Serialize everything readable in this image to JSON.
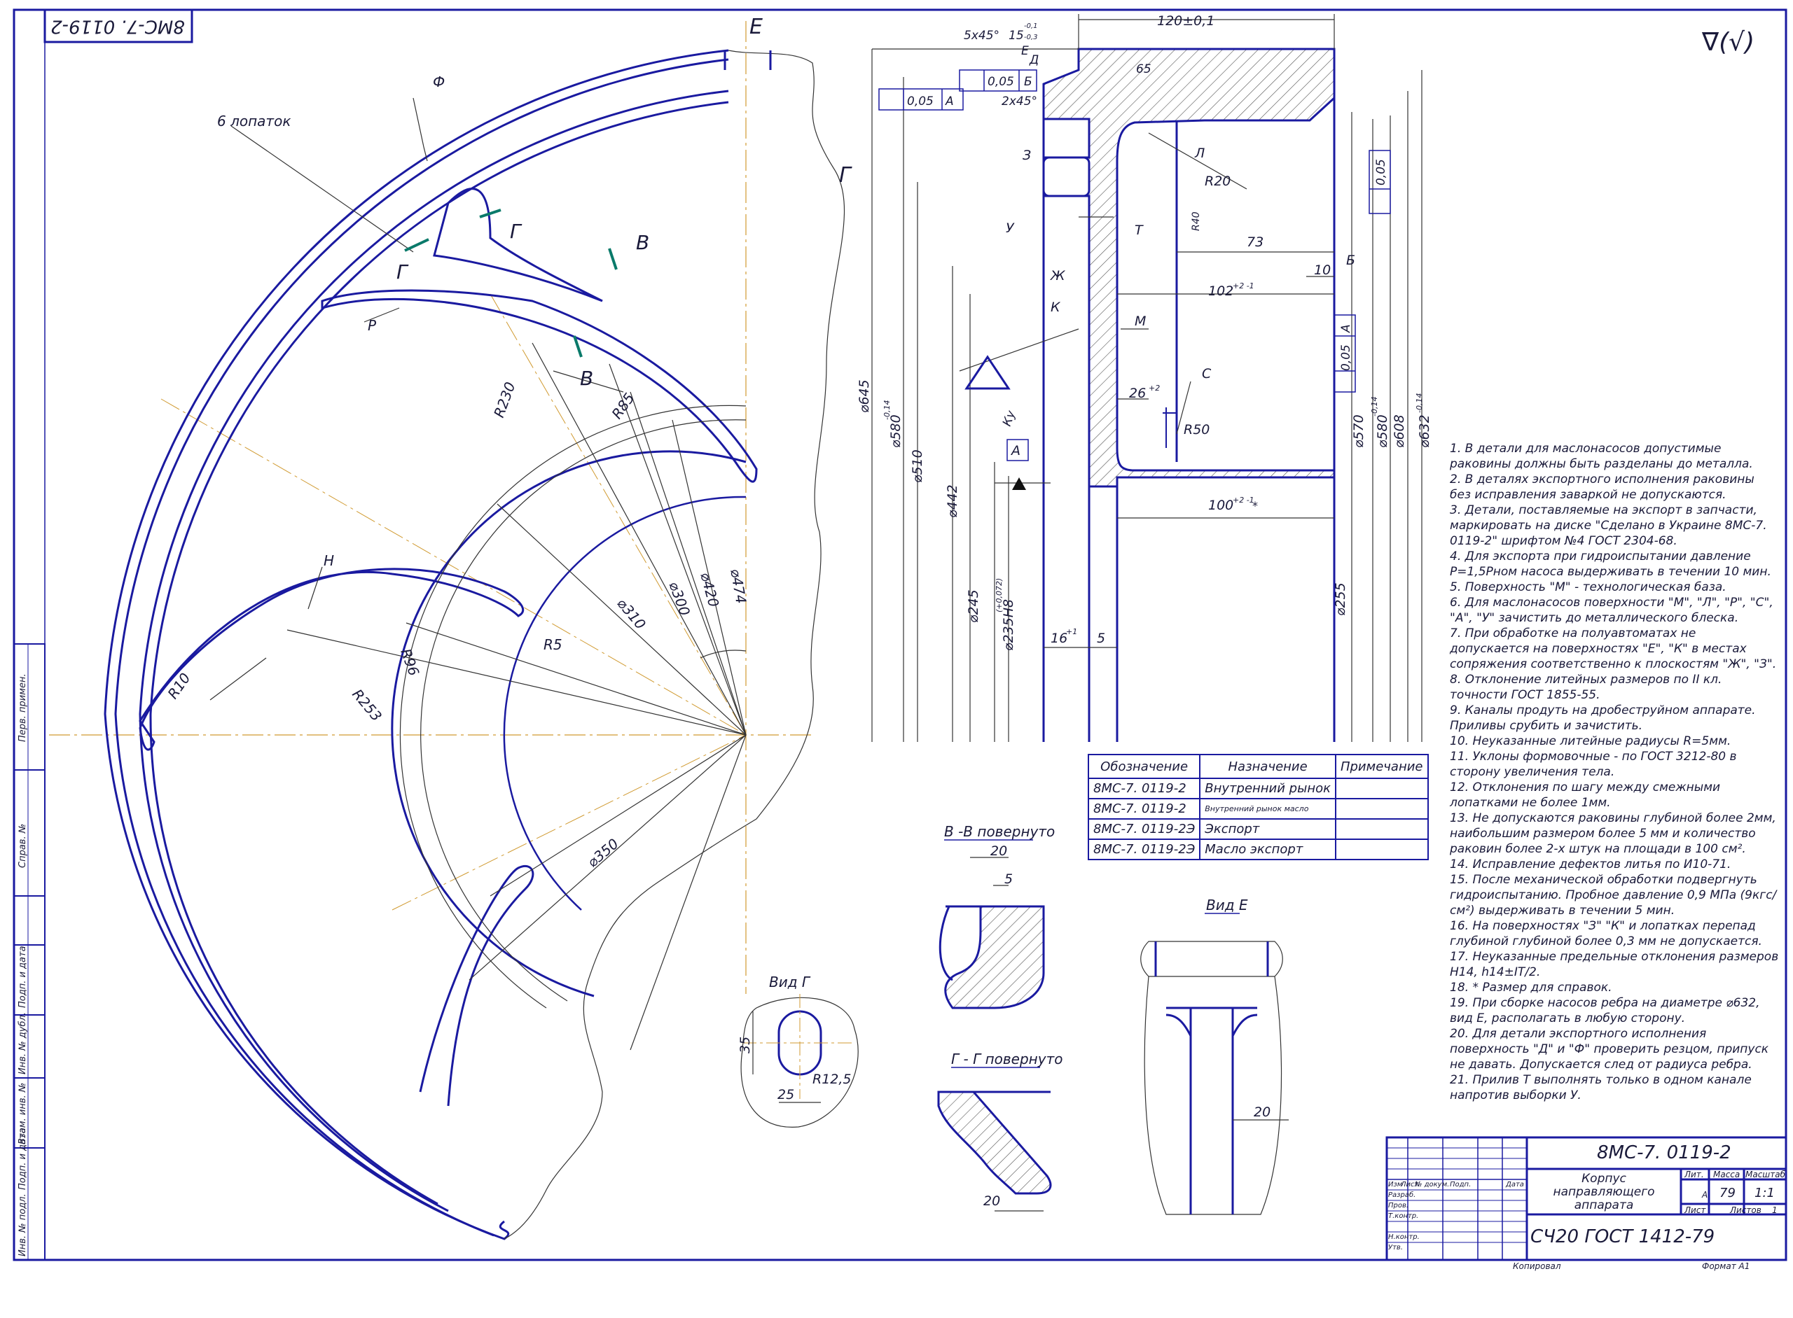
{
  "stamp_top": "8МС-7. 0119-2",
  "view_arrows": {
    "e": "Е",
    "g": "Г",
    "v1": "В",
    "v2": "В",
    "g2": "Г",
    "g3": "Г"
  },
  "plan_labels": {
    "f": "Ф",
    "blades": "6 лопаток",
    "p": "Р",
    "n": "Н",
    "r230": "R230",
    "r85": "R85",
    "r96": "R96",
    "r253": "R253",
    "r10": "R10",
    "r5": "R5",
    "d300": "⌀300",
    "d420": "⌀420",
    "d474": "⌀474",
    "d310": "⌀310",
    "d350": "⌀350"
  },
  "section_labels": {
    "dim120": "120±0,1",
    "chamfer1": "5х45°",
    "dim15": "15",
    "dim15_tol_up": "-0,1",
    "dim15_tol_dn": "-0,3",
    "e": "Е",
    "d": "Д",
    "dim65": "65",
    "tol1_val": "0,05",
    "tol1_ref": "Б",
    "tol2_val": "0,05",
    "tol2_ref": "А",
    "chamfer2": "2х45°",
    "z": "З",
    "u": "У",
    "t": "Т",
    "zh": "Ж",
    "k": "К",
    "m": "М",
    "l": "Л",
    "s": "С",
    "ku": "Ку",
    "r20": "R20",
    "r40": "R40",
    "r50": "R50",
    "dim73": "73",
    "dim10": "10",
    "b": "Б",
    "dim102": "102",
    "dim102_tol": "+2 -1",
    "dim26": "26",
    "dim26_tol": "+2",
    "dim100": "100",
    "dim100_tol": "+2 -1",
    "dim100_star": "*",
    "dim16": "16",
    "dim16_tol": "+1",
    "dim5": "5",
    "datum_a": "А",
    "tol3_val": "0,05",
    "tol3_ref": "А",
    "tol4_val": "0,05",
    "d645": "⌀645",
    "d580": "⌀580",
    "d580_tol": "-0,14",
    "d510": "⌀510",
    "d442": "⌀442",
    "d245": "⌀245",
    "d235": "⌀235Н8",
    "d235_tol": "(+0,072)",
    "d255": "⌀255",
    "d570": "⌀570",
    "d580b": "⌀580",
    "d580b_tol": "-0,14",
    "d608": "⌀608",
    "d632": "⌀632",
    "d632_tol": "-0,14",
    "rough": "∇(√)"
  },
  "views": {
    "v_title": "В -В повернуто",
    "v_dim20": "20",
    "v_dim5": "5",
    "g_title": "Г - Г повернуто",
    "g_dim20": "20",
    "vg_title": "Вид Г",
    "vg_dim35": "35",
    "vg_dim25": "25",
    "vg_r": "R12,5",
    "ve_title": "Вид Е",
    "ve_dim20": "20"
  },
  "spec_table": {
    "headers": [
      "Обозначение",
      "Назначение",
      "Примечание"
    ],
    "rows": [
      [
        "8МС-7. 0119-2",
        "Внутренний рынок",
        ""
      ],
      [
        "8МС-7. 0119-2",
        "Внутренний рынок масло",
        ""
      ],
      [
        "8МС-7. 0119-2Э",
        "Экспорт",
        ""
      ],
      [
        "8МС-7. 0119-2Э",
        "Масло экспорт",
        ""
      ]
    ]
  },
  "notes": [
    "1. В детали для маслонасосов допустимые раковины должны быть разделаны до металла.",
    "2. В деталях экспортного исполнения раковины без исправления заваркой не допускаются.",
    "3. Детали, поставляемые на экспорт в запчасти, маркировать на диске \"Сделано в Украине 8МС-7. 0119-2\" шрифтом №4 ГОСТ 2304-68.",
    "4. Для экспорта при гидроиспытании давление Р=1,5Рном насоса выдерживать в течении 10 мин.",
    "5. Поверхность \"М\" - технологическая база.",
    "6. Для маслонасосов поверхности \"М\", \"Л\", \"Р\", \"С\", \"А\", \"У\" зачистить до металлического блеска.",
    "7. При обработке на полуавтоматах не допускается на поверхностях \"Е\", \"К\" в местах сопряжения соответственно к плоскостям \"Ж\", \"З\".",
    "8. Отклонение литейных размеров по II кл. точности ГОСТ 1855-55.",
    "9. Каналы продуть на дробеструйном аппарате. Приливы срубить и зачистить.",
    "10. Неуказанные литейные радиусы R=5мм.",
    "11. Уклоны формовочные - по ГОСТ 3212-80 в сторону увеличения тела.",
    "12. Отклонения по шагу между смежными лопатками не более 1мм.",
    "13. Не допускаются раковины глубиной более 2мм, наибольшим размером более 5 мм и количество раковин более 2-х штук на площади в 100 см².",
    "14. Исправление дефектов литья по И10-71.",
    "15. После механической обработки подвергнуть гидроиспытанию. Пробное давление 0,9 МПа (9кгс/см²) выдерживать в течении 5 мин.",
    "16. На поверхностях \"З\" \"К\" и лопатках перепад глубиной глубиной более 0,3 мм не допускается.",
    "17. Неуказанные предельные отклонения размеров Н14, h14±IT/2.",
    "18. * Размер для справок.",
    "19. При сборке насосов ребра на диаметре ⌀632, вид Е, располагать в любую сторону.",
    "20. Для детали экспортного исполнения поверхность \"Д\" и \"Ф\" проверить резцом, припуск не давать. Допускается след от радиуса ребра.",
    "21. Прилив Т выполнять только в одном канале напротив выборки У."
  ],
  "title_block": {
    "doc_number": "8МС-7. 0119-2",
    "part_name": "Корпус направляющего аппарата",
    "material": "СЧ20 ГОСТ 1412-79",
    "lit_label": "Лит.",
    "mass_label": "Масса",
    "scale_label": "Масштаб",
    "lit_value": "А",
    "mass_value": "79",
    "scale_value": "1:1",
    "sheet_label": "Лист",
    "sheets_label": "Листов",
    "sheets_value": "1",
    "col_headers": [
      "Изм",
      "Лист",
      "№ докум.",
      "Подп.",
      "Дата"
    ],
    "roles": [
      "Разраб.",
      "Пров.",
      "Т.контр.",
      "",
      "Н.контр.",
      "Утв."
    ],
    "copied": "Копировал",
    "format": "Формат А1"
  },
  "side_stamps": [
    "Перв. примен.",
    "Справ. №",
    "Подп. и дата",
    "Инв. № дубл.",
    "Взам. инв. №",
    "Подп. и дата",
    "Инв. № подл."
  ]
}
